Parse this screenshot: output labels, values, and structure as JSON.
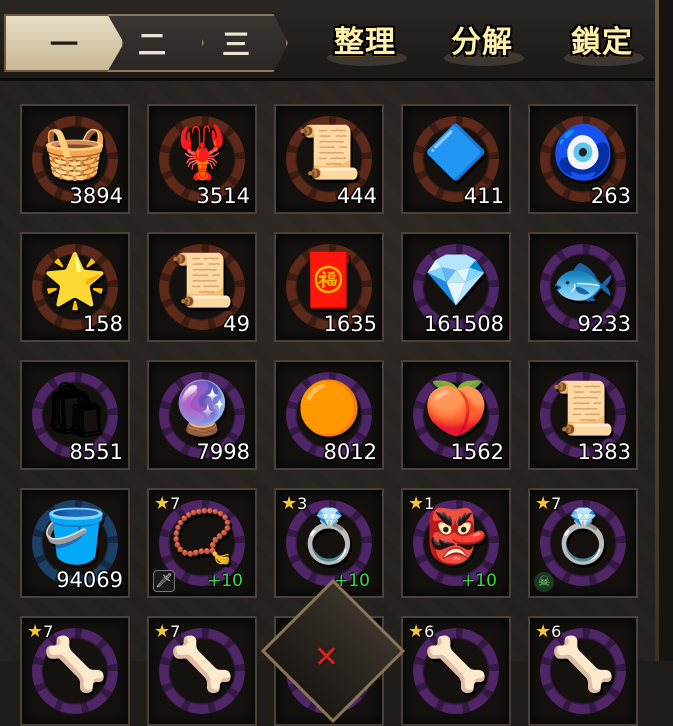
{
  "tabs": [
    {
      "label": "一",
      "active": true
    },
    {
      "label": "二",
      "active": false
    },
    {
      "label": "三",
      "active": false
    }
  ],
  "actions": {
    "sort": "整理",
    "decompose": "分解",
    "lock": "鎖定"
  },
  "rows": [
    [
      {
        "icon": "rice-basket-icon",
        "glyph": "🧺",
        "ring": "#6a2e1c",
        "count": "3894"
      },
      {
        "icon": "lobster-icon",
        "glyph": "🦞",
        "ring": "#6a2e1c",
        "count": "3514"
      },
      {
        "icon": "scroll-icon",
        "glyph": "📜",
        "ring": "#6a2e1c",
        "count": "444"
      },
      {
        "icon": "crystal-stone-icon",
        "glyph": "🔷",
        "ring": "#6a2e1c",
        "count": "411"
      },
      {
        "icon": "charm-icon",
        "glyph": "🧿",
        "ring": "#6a2e1c",
        "count": "263"
      }
    ],
    [
      {
        "icon": "gold-badge-icon",
        "glyph": "🌟",
        "ring": "#6a2e1c",
        "count": "158"
      },
      {
        "icon": "hammer-scroll-icon",
        "glyph": "📜",
        "ring": "#6a2e1c",
        "count": "49"
      },
      {
        "icon": "lion-scroll-icon",
        "glyph": "🧧",
        "ring": "#6a2e1c",
        "count": "1635"
      },
      {
        "icon": "blue-gem-icon",
        "glyph": "💎",
        "ring": "#5a2a78",
        "count": "161508"
      },
      {
        "icon": "fish-icon",
        "glyph": "🐟",
        "ring": "#5a2a78",
        "count": "9233"
      }
    ],
    [
      {
        "icon": "flour-sack-icon",
        "glyph": "🛍",
        "ring": "#5a2a78",
        "count": "8551"
      },
      {
        "icon": "purple-orb-icon",
        "glyph": "🔮",
        "ring": "#5a2a78",
        "count": "7998"
      },
      {
        "icon": "orange-orb-icon",
        "glyph": "🟠",
        "ring": "#5a2a78",
        "count": "8012"
      },
      {
        "icon": "peach-icon",
        "glyph": "🍑",
        "ring": "#5a2a78",
        "count": "1562"
      },
      {
        "icon": "seal-scroll-icon",
        "glyph": "📜",
        "ring": "#5a2a78",
        "count": "1383"
      }
    ],
    [
      {
        "icon": "soup-bucket-icon",
        "glyph": "🪣",
        "ring": "#1e4a78",
        "count": "94069"
      },
      {
        "icon": "amulet-necklace-icon",
        "glyph": "📿",
        "ring": "#5a2a78",
        "stars": "7",
        "plus": "+10",
        "tag": "sword"
      },
      {
        "icon": "gold-bracelet-icon",
        "glyph": "💍",
        "ring": "#5a2a78",
        "stars": "3",
        "plus": "+10"
      },
      {
        "icon": "fox-mask-icon",
        "glyph": "👺",
        "ring": "#5a2a78",
        "stars": "1",
        "plus": "+10"
      },
      {
        "icon": "jeweled-ring-icon",
        "glyph": "💍",
        "ring": "#5a2a78",
        "stars": "7",
        "tag": "skull"
      }
    ],
    [
      {
        "icon": "horn-item-icon",
        "glyph": "🦴",
        "ring": "#5a2a78",
        "stars": "7"
      },
      {
        "icon": "horn-item-icon",
        "glyph": "🦴",
        "ring": "#5a2a78",
        "stars": "7"
      },
      {
        "icon": "empty-slot-icon",
        "glyph": "",
        "ring": "#5a2a78"
      },
      {
        "icon": "horn-item-icon",
        "glyph": "🦴",
        "ring": "#5a2a78",
        "stars": "6"
      },
      {
        "icon": "horn-item-icon",
        "glyph": "🦴",
        "ring": "#5a2a78",
        "stars": "6"
      }
    ]
  ],
  "tags": {
    "sword": "🗡",
    "skull": "☠"
  },
  "bottom_button": {
    "icon": "close-icon",
    "glyph": "✕"
  }
}
